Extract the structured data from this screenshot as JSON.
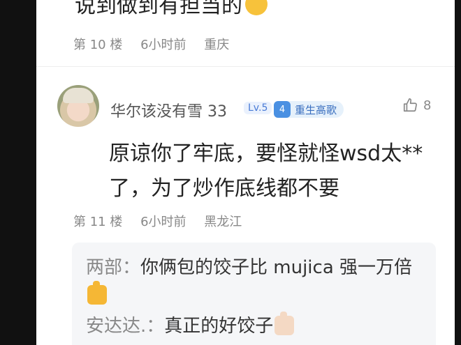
{
  "colors": {
    "accent": "#4a90e2",
    "text": "#222222",
    "meta": "#888888",
    "reply_bg": "#f5f6f8"
  },
  "prev_comment": {
    "cut_text": "说到做到有担当的",
    "floor": "第 10 楼",
    "time": "6小时前",
    "location": "重庆"
  },
  "comment": {
    "username": "华尔该没有雪 33",
    "level": "Lv.5",
    "fan_badge": {
      "number": "4",
      "text": "重生高歌"
    },
    "likes": "8",
    "text": "原谅你了牢底，要怪就怪wsd太**了，为了炒作底线都不要",
    "floor": "第 11 楼",
    "time": "6小时前",
    "location": "黑龙江",
    "replies": [
      {
        "author": "两部：",
        "text": "你俩包的饺子比 mujica 强一万倍",
        "emoji": "thumbs-up-icon"
      },
      {
        "author": "安达达.：",
        "text": "真正的好饺子",
        "emoji": "thumbs-up-icon"
      }
    ]
  }
}
